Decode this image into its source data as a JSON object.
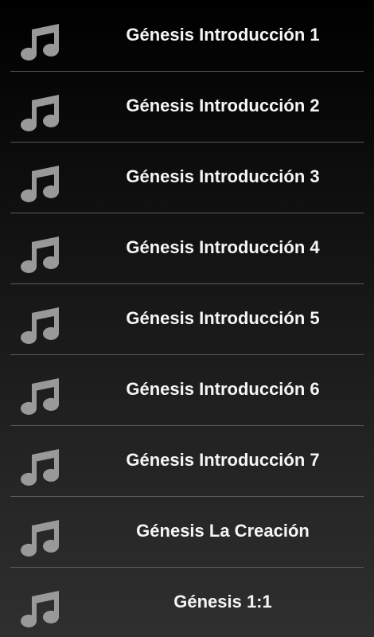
{
  "list": {
    "items": [
      {
        "label": "Génesis Introducción 1",
        "icon": "music-note-icon"
      },
      {
        "label": "Génesis Introducción 2",
        "icon": "music-note-icon"
      },
      {
        "label": "Génesis Introducción 3",
        "icon": "music-note-icon"
      },
      {
        "label": "Génesis Introducción 4",
        "icon": "music-note-icon"
      },
      {
        "label": "Génesis Introducción 5",
        "icon": "music-note-icon"
      },
      {
        "label": "Génesis Introducción 6",
        "icon": "music-note-icon"
      },
      {
        "label": "Génesis Introducción 7",
        "icon": "music-note-icon"
      },
      {
        "label": "Génesis La Creación",
        "icon": "music-note-icon"
      },
      {
        "label": "Génesis 1:1",
        "icon": "music-note-icon"
      }
    ]
  },
  "colors": {
    "text": "#f5f5f5",
    "icon": "#999999",
    "divider": "#5a5a5a"
  }
}
